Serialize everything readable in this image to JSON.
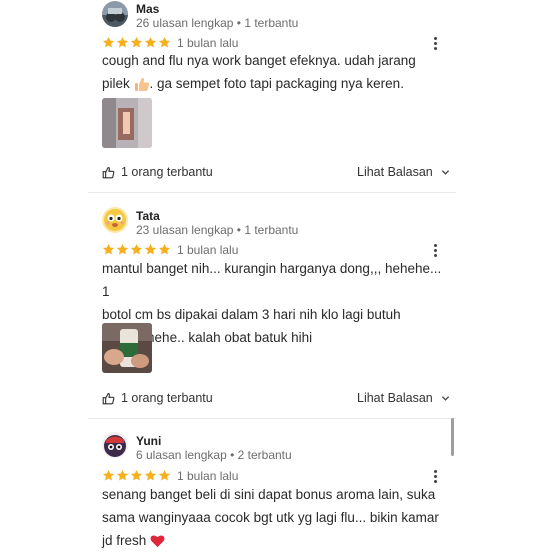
{
  "colors": {
    "star": "#f6b01e",
    "heart": "#e0263a",
    "text_muted": "#6d6d6d"
  },
  "reviews": [
    {
      "name": "Mas",
      "reviews_count": "26 ulasan lengkap",
      "helpful_count": "1 terbantu",
      "rating": 5,
      "time": "1 bulan lalu",
      "lines": [
        "cough and flu nya work banget efeknya. udah jarang",
        "pilek",
        ". ga sempet foto tapi packaging nya keren."
      ],
      "emoji_icon": "thumbs-up-icon",
      "helpful_label": "1 orang terbantu",
      "reply_label": "Lihat Balasan"
    },
    {
      "name": "Tata",
      "reviews_count": "23 ulasan lengkap",
      "helpful_count": "1 terbantu",
      "rating": 5,
      "time": "1 bulan lalu",
      "lines": [
        "mantul banget nih... kurangin harganya dong,,, hehehe... 1",
        "botol cm bs dipakai dalam 3 hari nih klo lagi butuh",
        "banget hehe.. kalah obat batuk hihi"
      ],
      "helpful_label": "1 orang terbantu",
      "reply_label": "Lihat Balasan"
    },
    {
      "name": "Yuni",
      "reviews_count": "6 ulasan lengkap",
      "helpful_count": "2 terbantu",
      "rating": 5,
      "time": "1 bulan lalu",
      "lines": [
        "senang banget beli di sini dapat bonus aroma lain, suka",
        "sama wanginyaaa cocok bgt utk yg lagi flu... bikin kamar",
        "jd fresh"
      ],
      "emoji_icon": "red-heart-icon"
    }
  ],
  "separator": "•"
}
